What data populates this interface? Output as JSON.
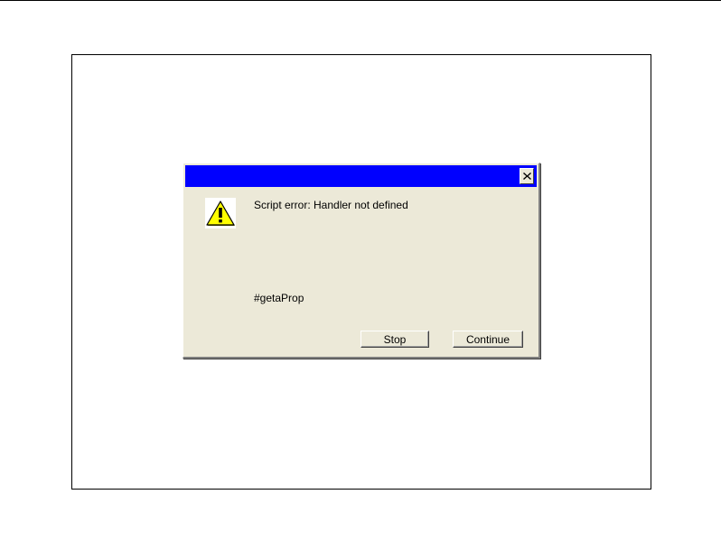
{
  "dialog": {
    "title": "",
    "message": "Script error: Handler not defined",
    "detail": "#getaProp",
    "icon": "warning-icon",
    "close_icon": "close-icon",
    "buttons": {
      "stop": "Stop",
      "continue": "Continue"
    }
  },
  "colors": {
    "titlebar": "#0000ff",
    "dialog_face": "#ece9d8",
    "warning_fill": "#ffff00"
  }
}
